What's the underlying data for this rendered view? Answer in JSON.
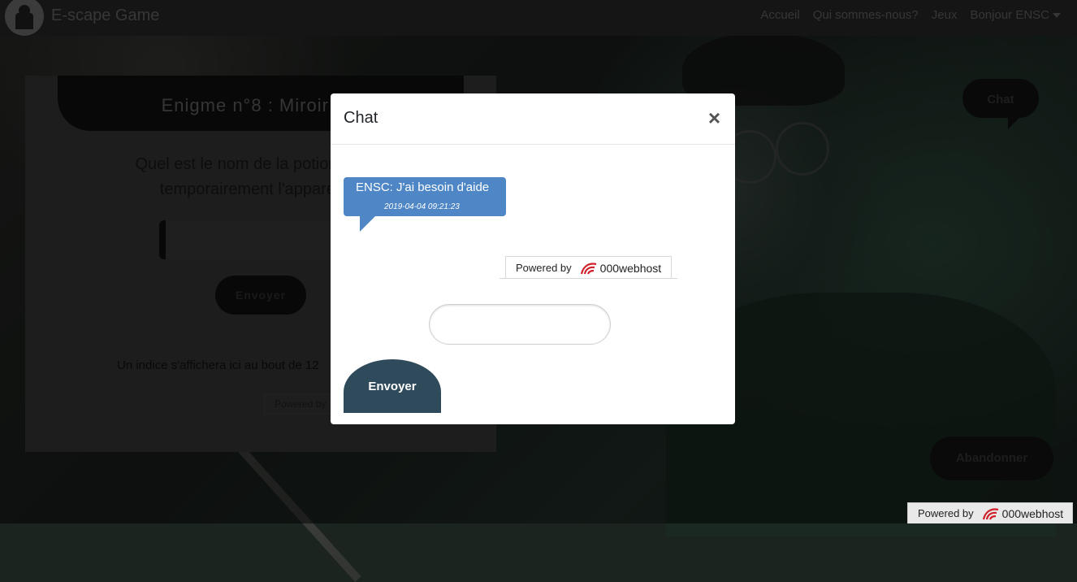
{
  "navbar": {
    "brand": "E-scape Game",
    "links": [
      "Accueil",
      "Qui sommes-nous?",
      "Jeux",
      "Bonjour ENSC"
    ]
  },
  "riddle": {
    "title": "Enigme n°8 : Miroir Oh",
    "question": "Quel est le nom de la potion qui pe temporairement l'apparence",
    "question_line1": "Quel est le nom de la potion qui pe",
    "question_line2": "temporairement l'apparence",
    "send_label": "Envoyer",
    "hint_text": "Un indice s'affichera ici au bout de 12",
    "powered_text": "Powered by"
  },
  "side_buttons": {
    "chat": "Chat",
    "abandon": "Abandonner"
  },
  "modal": {
    "title": "Chat",
    "close_symbol": "×",
    "messages": [
      {
        "text": "ENSC: J'ai besoin d'aide",
        "time": "2019-04-04 09:21:23"
      }
    ],
    "input_value": "",
    "send_label": "Envoyer"
  },
  "powered": {
    "prefix": "Powered by",
    "brand": "000webhost"
  },
  "colors": {
    "message_bubble": "#4f86c6",
    "send_button": "#2f4a5a",
    "navbar": "#2a2a2a"
  }
}
